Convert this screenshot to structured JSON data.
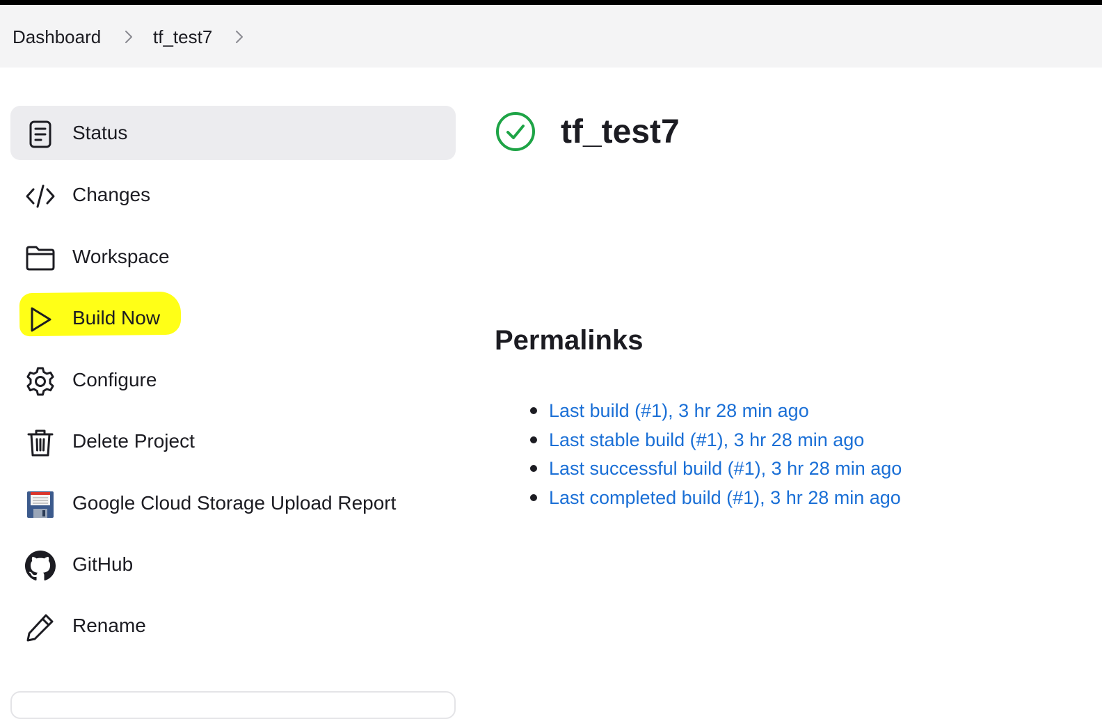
{
  "breadcrumb": {
    "items": [
      {
        "label": "Dashboard"
      },
      {
        "label": "tf_test7"
      }
    ]
  },
  "sidebar": {
    "items": [
      {
        "label": "Status",
        "icon": "status-document-icon",
        "active": true
      },
      {
        "label": "Changes",
        "icon": "code-icon"
      },
      {
        "label": "Workspace",
        "icon": "folder-icon"
      },
      {
        "label": "Build Now",
        "icon": "play-icon",
        "highlighted": true
      },
      {
        "label": "Configure",
        "icon": "gear-icon"
      },
      {
        "label": "Delete Project",
        "icon": "trash-icon"
      },
      {
        "label": "Google Cloud Storage Upload Report",
        "icon": "floppy-disk-icon"
      },
      {
        "label": "GitHub",
        "icon": "github-icon"
      },
      {
        "label": "Rename",
        "icon": "pencil-icon"
      }
    ]
  },
  "main": {
    "title": "tf_test7",
    "status_icon": "success-check-icon",
    "permalinks": {
      "heading": "Permalinks",
      "links": [
        "Last build (#1), 3 hr 28 min ago",
        "Last stable build (#1), 3 hr 28 min ago",
        "Last successful build (#1), 3 hr 28 min ago",
        "Last completed build (#1), 3 hr 28 min ago"
      ]
    }
  },
  "colors": {
    "link": "#1a6fd6",
    "success": "#1ea446",
    "highlight": "#ffff17",
    "active_item_bg": "#ececef",
    "breadcrumb_bg": "#f4f4f5"
  }
}
